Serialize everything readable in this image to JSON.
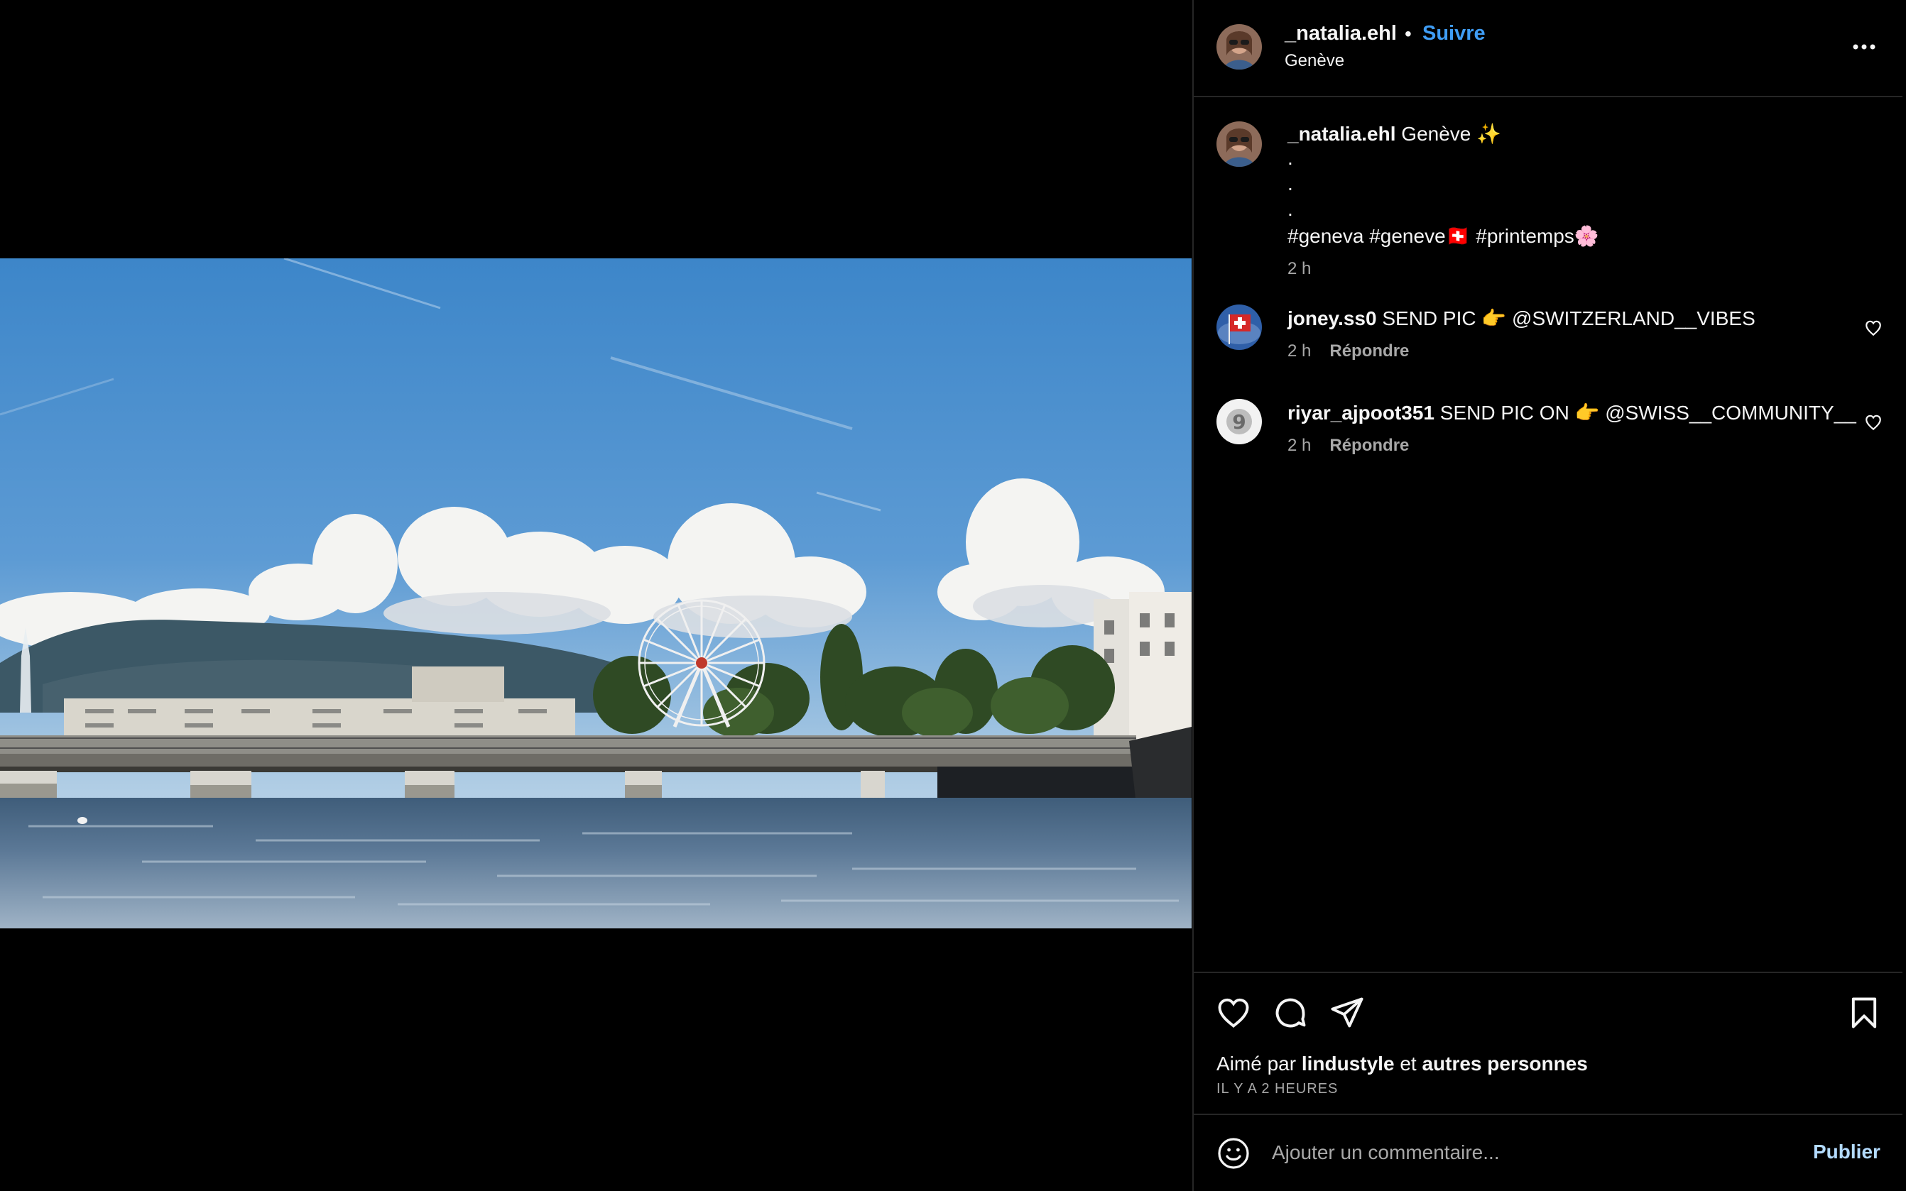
{
  "post": {
    "username": "_natalia.ehl",
    "separator": "•",
    "follow_label": "Suivre",
    "location": "Genève"
  },
  "caption": {
    "username": "_natalia.ehl",
    "title": "Genève ✨",
    "dot1": ".",
    "dot2": ".",
    "dot3": ".",
    "hashtags": "#geneva #geneve🇨🇭 #printemps🌸",
    "time": "2 h"
  },
  "comments": [
    {
      "username": "joney.ss0",
      "text": "SEND PIC 👉 @SWITZERLAND__VIBES",
      "time": "2 h",
      "reply_label": "Répondre"
    },
    {
      "username": "riyar_ajpoot351",
      "text": "SEND PIC ON 👉 @SWISS__COMMUNITY__",
      "time": "2 h",
      "reply_label": "Répondre"
    }
  ],
  "likes": {
    "prefix": "Aimé par",
    "user": "lindustyle",
    "conj": "et",
    "others": "autres personnes",
    "ago": "IL Y A 2 HEURES"
  },
  "composer": {
    "placeholder": "Ajouter un commentaire...",
    "publish_label": "Publier"
  },
  "icons": {
    "more": "more-horizontal-icon",
    "like": "heart-icon",
    "comment": "comment-icon",
    "share": "send-icon",
    "save": "bookmark-icon",
    "emoji": "emoji-icon"
  },
  "colors": {
    "background": "#000000",
    "text": "#f5f5f5",
    "secondary": "#a8a8a8",
    "link": "#3f9df5",
    "publish": "#b3dbff",
    "divider": "#262626"
  }
}
